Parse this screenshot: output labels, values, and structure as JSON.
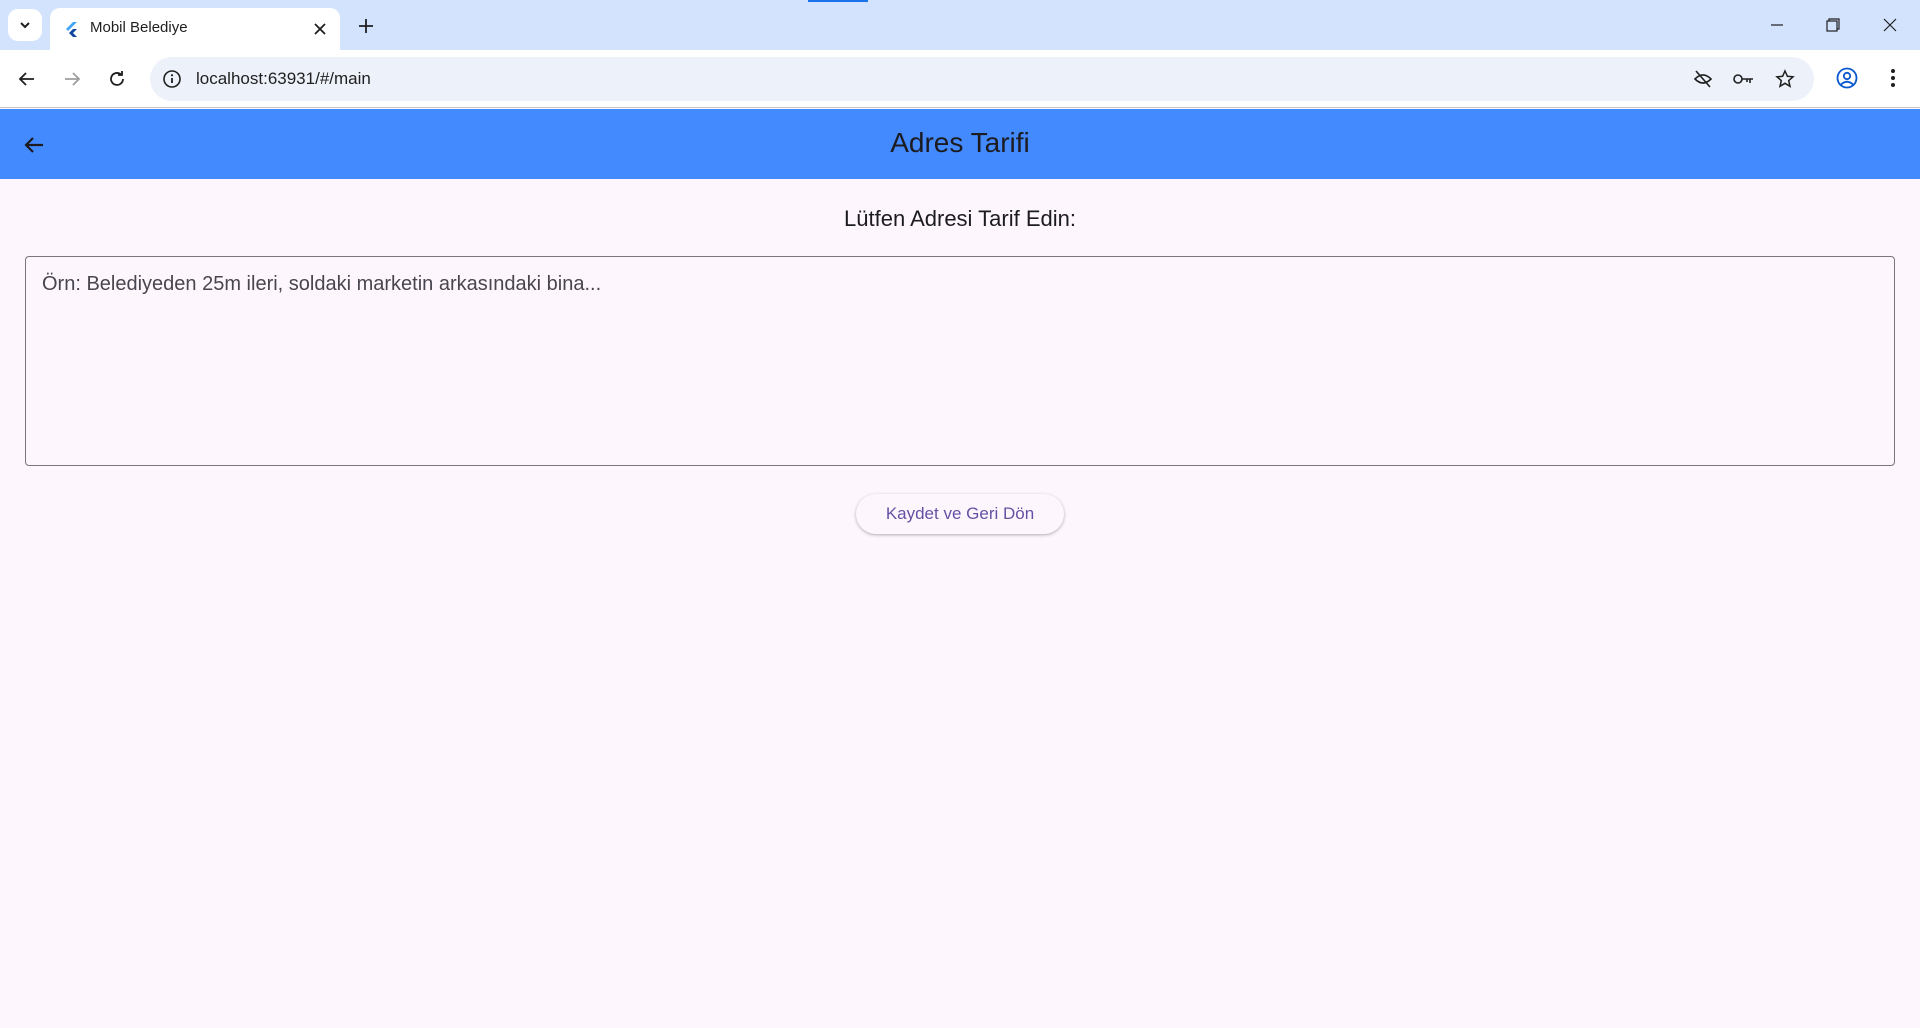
{
  "browser": {
    "tab_title": "Mobil Belediye",
    "url": "localhost:63931/#/main",
    "icons": {
      "tab_search": "chevron-down-icon",
      "favicon": "flutter-icon",
      "close_tab": "close-icon",
      "new_tab": "plus-icon",
      "minimize": "minimize-icon",
      "restore": "restore-icon",
      "close_window": "close-icon",
      "back": "arrow-left-icon",
      "forward": "arrow-right-icon",
      "reload": "reload-icon",
      "site_info": "info-icon",
      "tracking": "eye-off-icon",
      "password": "key-icon",
      "bookmark": "star-icon",
      "profile": "account-icon",
      "menu": "more-vert-icon"
    }
  },
  "app": {
    "appbar": {
      "title": "Adres Tarifi",
      "color": "#448aff",
      "back_icon": "arrow-left-icon"
    },
    "prompt": "Lütfen Adresi Tarif Edin:",
    "address_input": {
      "placeholder": "Örn: Belediyeden 25m ileri, soldaki marketin arkasındaki bina...",
      "value": ""
    },
    "save_button_label": "Kaydet ve Geri Dön",
    "accent_color": "#6750a4",
    "background_color": "#fdf7fd"
  }
}
